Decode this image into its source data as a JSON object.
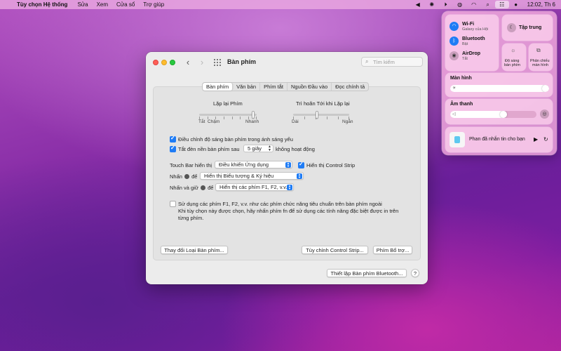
{
  "menubar": {
    "apple": "",
    "app_name": "Tùy chọn Hệ thống",
    "items": [
      "Sửa",
      "Xem",
      "Cửa sổ",
      "Trợ giúp"
    ],
    "clock": "12:02, Th 6"
  },
  "window": {
    "title": "Bàn phím",
    "search_placeholder": "Tìm kiếm",
    "tabs": [
      "Bàn phím",
      "Văn bản",
      "Phím tắt",
      "Nguồn Đầu vào",
      "Đọc chính tả"
    ],
    "selected_tab": "Bàn phím",
    "key_repeat": {
      "label": "Lặp lại Phím",
      "min_label": "Tắt",
      "slow_label": "Chậm",
      "max_label": "Nhanh",
      "value_fraction": 0.94
    },
    "delay_until_repeat": {
      "label": "Trì hoãn Tới khi Lặp lại",
      "min_label": "Dài",
      "max_label": "Ngắn",
      "value_fraction": 0.43
    },
    "adjust_brightness_label": "Điều chỉnh độ sáng bàn phím trong ánh sáng yếu",
    "adjust_brightness_checked": true,
    "backlight_off_prefix": "Tắt đèn nền bàn phím sau",
    "backlight_off_value": "5 giây",
    "backlight_off_suffix": "không hoạt động",
    "backlight_off_checked": true,
    "touchbar_label": "Touch Bar hiển thị",
    "touchbar_value": "Điều khiển Ứng dụng",
    "show_control_strip_label": "Hiển thị Control Strip",
    "show_control_strip_checked": true,
    "press_label_a": "Nhấn",
    "press_label_b": "để",
    "press_value": "Hiển thị Biểu tượng & Ký hiệu",
    "hold_label_a": "Nhấn và giữ",
    "hold_label_b": "để",
    "hold_value": "Hiển thị các phím F1, F2, v.v.",
    "fn_keys_label": "Sử dụng các phím F1, F2, v.v. như các phím chức năng tiêu chuẩn trên bàn phím ngoài",
    "fn_keys_checked": false,
    "fn_keys_help_1": "Khi tùy chọn này được chọn, hãy nhấn phím fn để sử dụng các tính năng đặc biệt được in trên",
    "fn_keys_help_2": "từng phím.",
    "change_keyboard_type_button": "Thay đổi Loại Bàn phím...",
    "customize_control_strip_button": "Tùy chỉnh Control Strip...",
    "modifier_keys_button": "Phím Bổ trợ...",
    "bluetooth_keyboard_button": "Thiết lập Bàn phím Bluetooth...",
    "help_button": "?"
  },
  "control_center": {
    "wifi": {
      "title": "Wi-Fi",
      "subtitle": "Galaxy của Hội"
    },
    "bluetooth": {
      "title": "Bluetooth",
      "subtitle": "Bật"
    },
    "airdrop": {
      "title": "AirDrop",
      "subtitle": "Tắt"
    },
    "focus": {
      "title": "Tập trung"
    },
    "keyboard_brightness": {
      "title_1": "Độ sáng",
      "title_2": "bàn phím"
    },
    "screen_mirroring": {
      "title_1": "Phản chiếu",
      "title_2": "màn hình"
    },
    "display": {
      "title": "Màn hình",
      "value_fraction": 1.0
    },
    "sound": {
      "title": "Âm thanh",
      "value_fraction": 0.63
    },
    "now_playing": {
      "title": "Phan đã nhắn tin cho bạn"
    }
  }
}
